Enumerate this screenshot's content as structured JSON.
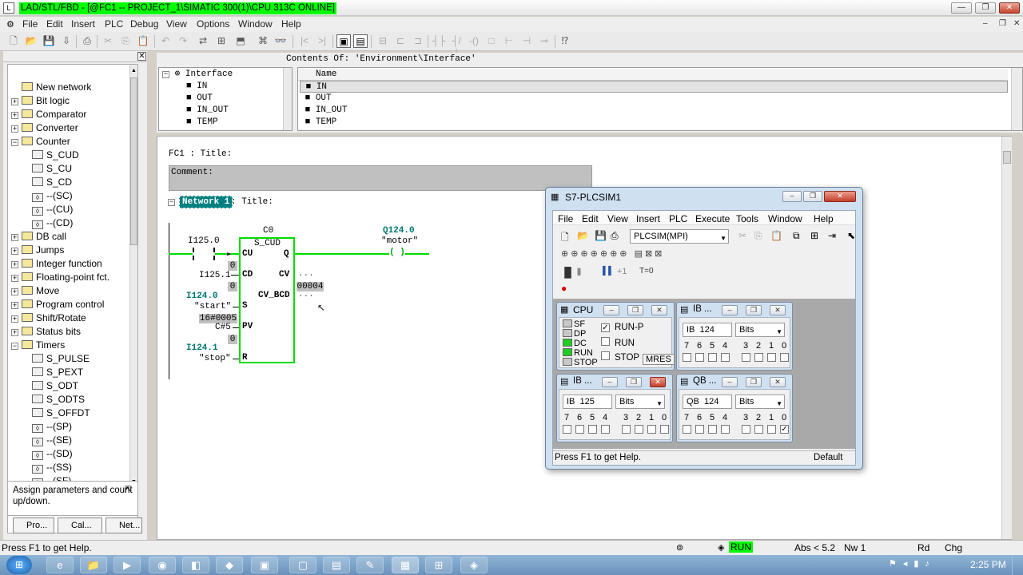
{
  "window": {
    "title": "LAD/STL/FBD  - [@FC1 -- PROJECT_1\\SIMATIC 300(1)\\CPU 313C  ONLINE]",
    "min": "—",
    "max": "❐",
    "close": "✕"
  },
  "menu": [
    "File",
    "Edit",
    "Insert",
    "PLC",
    "Debug",
    "View",
    "Options",
    "Window",
    "Help"
  ],
  "mdi_controls": [
    "–",
    "❐",
    "✕"
  ],
  "catalog": {
    "items": [
      {
        "label": "New network",
        "expander": "",
        "icon": "new-network-icon"
      },
      {
        "label": "Bit logic",
        "expander": "+",
        "icon": "bit-logic-icon"
      },
      {
        "label": "Comparator",
        "expander": "+",
        "icon": "comparator-icon"
      },
      {
        "label": "Converter",
        "expander": "+",
        "icon": "converter-icon"
      },
      {
        "label": "Counter",
        "expander": "−",
        "icon": "counter-icon"
      },
      {
        "label": "S_CUD",
        "expander": "",
        "icon": "block-icon",
        "indent": 1
      },
      {
        "label": "S_CU",
        "expander": "",
        "icon": "block-icon",
        "indent": 1
      },
      {
        "label": "S_CD",
        "expander": "",
        "icon": "block-icon",
        "indent": 1
      },
      {
        "label": "--(SC)",
        "expander": "",
        "icon": "coil-icon",
        "indent": 1
      },
      {
        "label": "--(CU)",
        "expander": "",
        "icon": "coil-icon",
        "indent": 1
      },
      {
        "label": "--(CD)",
        "expander": "",
        "icon": "coil-icon",
        "indent": 1
      },
      {
        "label": "DB call",
        "expander": "+",
        "icon": "db-call-icon"
      },
      {
        "label": "Jumps",
        "expander": "+",
        "icon": "jumps-icon"
      },
      {
        "label": "Integer function",
        "expander": "+",
        "icon": "integer-function-icon"
      },
      {
        "label": "Floating-point fct.",
        "expander": "+",
        "icon": "floating-point-icon"
      },
      {
        "label": "Move",
        "expander": "+",
        "icon": "move-icon"
      },
      {
        "label": "Program control",
        "expander": "+",
        "icon": "program-control-icon"
      },
      {
        "label": "Shift/Rotate",
        "expander": "+",
        "icon": "shift-rotate-icon"
      },
      {
        "label": "Status bits",
        "expander": "+",
        "icon": "status-bits-icon"
      },
      {
        "label": "Timers",
        "expander": "−",
        "icon": "timers-icon"
      },
      {
        "label": "S_PULSE",
        "expander": "",
        "icon": "block-icon",
        "indent": 1
      },
      {
        "label": "S_PEXT",
        "expander": "",
        "icon": "block-icon",
        "indent": 1
      },
      {
        "label": "S_ODT",
        "expander": "",
        "icon": "block-icon",
        "indent": 1
      },
      {
        "label": "S_ODTS",
        "expander": "",
        "icon": "block-icon",
        "indent": 1
      },
      {
        "label": "S_OFFDT",
        "expander": "",
        "icon": "block-icon",
        "indent": 1
      },
      {
        "label": "--(SP)",
        "expander": "",
        "icon": "coil-icon",
        "indent": 1
      },
      {
        "label": "--(SE)",
        "expander": "",
        "icon": "coil-icon",
        "indent": 1
      },
      {
        "label": "--(SD)",
        "expander": "",
        "icon": "coil-icon",
        "indent": 1
      },
      {
        "label": "--(SS)",
        "expander": "",
        "icon": "coil-icon",
        "indent": 1
      },
      {
        "label": "--(SF)",
        "expander": "",
        "icon": "coil-icon",
        "indent": 1
      }
    ],
    "hint": "Assign parameters and count up/down.",
    "tabs": [
      "Pro...",
      "Cal...",
      "Net..."
    ]
  },
  "interface": {
    "contents_label": "Contents Of: 'Environment\\Interface'",
    "tree_root": "Interface",
    "tree_items": [
      "IN",
      "OUT",
      "IN_OUT",
      "TEMP"
    ],
    "list_header": "Name",
    "list_items": [
      "IN",
      "OUT",
      "IN_OUT",
      "TEMP"
    ]
  },
  "editor": {
    "block_title": "FC1 : Title:",
    "comment": "Comment:",
    "network_label": "Network 1",
    "network_title": ": Title:",
    "counter_name": "C0",
    "block_type": "S_CUD",
    "pins": {
      "cu": "CU",
      "q": "Q",
      "cd": "CD",
      "cv": "CV",
      "cv_bcd": "CV_BCD",
      "s": "S",
      "pv": "PV",
      "r": "R"
    },
    "inputs": {
      "cu_addr": "I125.0",
      "cd_addr": "I125.1",
      "s_addr": "I124.0",
      "s_sym": "\"start\"",
      "pv_val": "16#0005",
      "pv_const": "C#5",
      "r_addr": "I124.1",
      "r_sym": "\"stop\""
    },
    "status_zeros": [
      "0",
      "0",
      "0",
      "0"
    ],
    "output_addr": "Q124.0",
    "output_sym": "\"motor\"",
    "coil": "( )",
    "cv_out": "...",
    "cv_bcd_value": "00004",
    "cv_bcd_out": "..."
  },
  "plcsim": {
    "title": "S7-PLCSIM1",
    "menu": [
      "File",
      "Edit",
      "View",
      "Insert",
      "PLC",
      "Execute",
      "Tools",
      "Window",
      "Help"
    ],
    "connection": "PLCSIM(MPI)",
    "connection_bold": "MPI",
    "toolbar2": [
      "▌▌",
      "+1",
      "T=0"
    ],
    "cpu": {
      "title": "CPU",
      "leds": [
        "SF",
        "DP",
        "DC",
        "RUN",
        "STOP"
      ],
      "led_colors": [
        "#c8c8c8",
        "#c8c8c8",
        "#22cc22",
        "#22cc22",
        "#c8c8c8"
      ],
      "modes": [
        {
          "label": "RUN-P",
          "checked": true
        },
        {
          "label": "RUN",
          "checked": false
        },
        {
          "label": "STOP",
          "checked": false
        }
      ],
      "mres": "MRES"
    },
    "modules": [
      {
        "title": "IB ...",
        "area": "IB",
        "addr": "124",
        "format": "Bits",
        "bits": [
          "7",
          "6",
          "5",
          "4",
          "3",
          "2",
          "1",
          "0"
        ],
        "checked": [
          false,
          false,
          false,
          false,
          false,
          false,
          false,
          false
        ]
      },
      {
        "title": "IB ...",
        "area": "IB",
        "addr": "125",
        "format": "Bits",
        "bits": [
          "7",
          "6",
          "5",
          "4",
          "3",
          "2",
          "1",
          "0"
        ],
        "checked": [
          false,
          false,
          false,
          false,
          false,
          false,
          false,
          false
        ]
      },
      {
        "title": "QB ...",
        "area": "QB",
        "addr": "124",
        "format": "Bits",
        "bits": [
          "7",
          "6",
          "5",
          "4",
          "3",
          "2",
          "1",
          "0"
        ],
        "checked": [
          false,
          false,
          false,
          false,
          false,
          false,
          false,
          true
        ]
      }
    ],
    "status_left": "Press F1 to get Help.",
    "status_right": "Default"
  },
  "statusbar": {
    "help": "Press F1 to get Help.",
    "mode": "RUN",
    "abs": "Abs < 5.2",
    "nw": "Nw 1",
    "rd": "Rd",
    "chg": "Chg"
  },
  "taskbar": {
    "clock": "2:25 PM"
  },
  "colors": {
    "online_title": "#00ff00",
    "network_highlight": "#008080",
    "rlo_true": "#00dd00"
  }
}
